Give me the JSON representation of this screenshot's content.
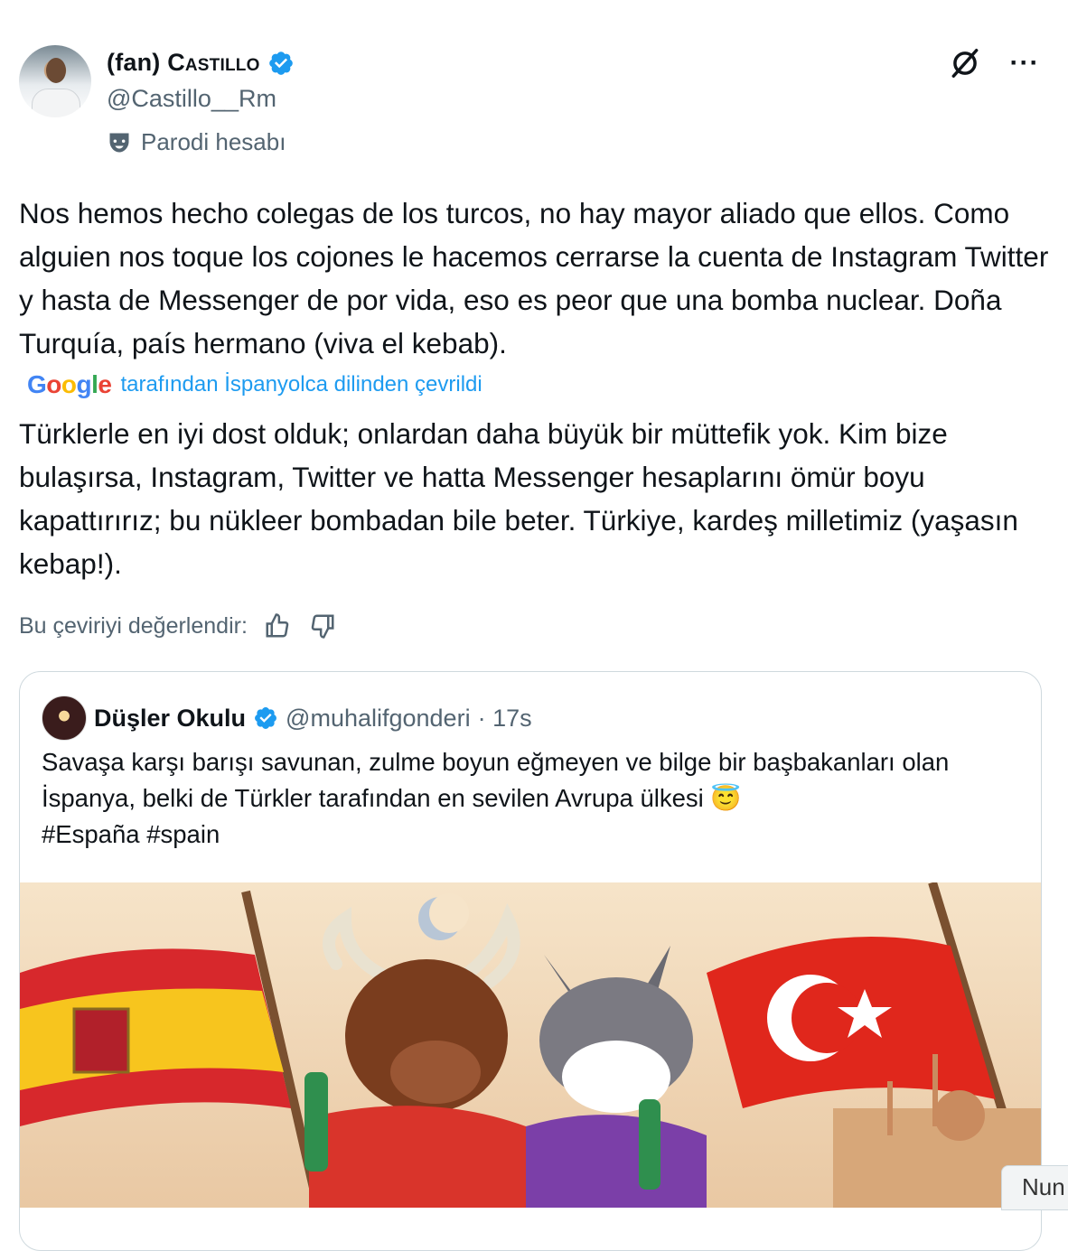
{
  "author": {
    "name_prefix": "(fan) ",
    "name_main": "Castillo",
    "handle": "@Castillo__Rm",
    "parody_label": "Parodi hesabı",
    "verified": true
  },
  "top_icons": {
    "grok": "grok-icon",
    "more": "···"
  },
  "tweet": {
    "original_text": "Nos hemos hecho colegas de los turcos, no hay mayor aliado que ellos. Como alguien nos toque los cojones le hacemos cerrarse la cuenta de Instagram Twitter y hasta de Messenger de por vida, eso es peor que una bomba nuclear. Doña Turquía, país hermano (viva el kebab).",
    "translation_notice": "tarafından İspanyolca dilinden çevrildi",
    "google_logo": "Google",
    "translated_text": "Türklerle en iyi dost olduk; onlardan daha büyük bir müttefik yok. Kim bize bulaşırsa, Instagram, Twitter ve hatta Messenger hesaplarını ömür boyu kapattırırız; bu nükleer bombadan bile beter. Türkiye, kardeş milletimiz (yaşasın kebap!).",
    "rate_label": "Bu çeviriyi değerlendir:"
  },
  "quote": {
    "name": "Düşler Okulu",
    "handle": "@muhalifgonderi",
    "time": "· 17s",
    "text": "Savaşa karşı barışı savunan, zulme boyun eğmeyen ve bilge bir başbakanları olan İspanya, belki de Türkler tarafından en sevilen Avrupa ülkesi 😇",
    "hashtags": "#España #spain"
  },
  "overlay_chip": "Nun",
  "colors": {
    "accent": "#1d9bf0",
    "muted": "#536471",
    "border": "#cfd9de"
  }
}
